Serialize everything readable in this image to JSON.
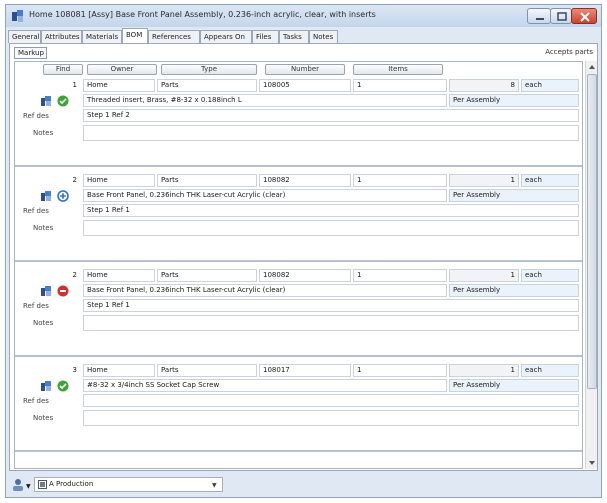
{
  "window": {
    "title": "Home 108081 [Assy] Base Front Panel Assembly, 0.236-inch acrylic, clear, with inserts"
  },
  "tabs": [
    {
      "label": "General"
    },
    {
      "label": "Attributes"
    },
    {
      "label": "Materials"
    },
    {
      "label": "BOM",
      "active": true
    },
    {
      "label": "References"
    },
    {
      "label": "Appears On"
    },
    {
      "label": "Files"
    },
    {
      "label": "Tasks"
    },
    {
      "label": "Notes"
    }
  ],
  "subtab": {
    "label": "Markup"
  },
  "accepts_parts": "Accepts parts",
  "columns": {
    "find": "Find",
    "owner": "Owner",
    "type": "Type",
    "number": "Number",
    "items": "Items"
  },
  "row_labels": {
    "ref_des": "Ref des",
    "notes": "Notes"
  },
  "bom_items": [
    {
      "find": "1",
      "owner": "Home",
      "type": "Parts",
      "number": "108005",
      "rev": "1",
      "qty": "8",
      "unit": "each",
      "description": "Threaded insert, Brass, #8-32 x 0.188inch L",
      "per": "Per Assembly",
      "ref_des": "Step 1 Ref 2",
      "notes": "",
      "status": "check"
    },
    {
      "find": "2",
      "owner": "Home",
      "type": "Parts",
      "number": "108082",
      "rev": "1",
      "qty": "1",
      "unit": "each",
      "description": "Base Front Panel, 0.236inch THK Laser-cut Acrylic (clear)",
      "per": "Per Assembly",
      "ref_des": "Step 1 Ref 1",
      "notes": "",
      "status": "add"
    },
    {
      "find": "2",
      "owner": "Home",
      "type": "Parts",
      "number": "108082",
      "rev": "1",
      "qty": "1",
      "unit": "each",
      "description": "Base Front Panel, 0.236inch THK Laser-cut Acrylic (clear)",
      "per": "Per Assembly",
      "ref_des": "Step 1 Ref 1",
      "notes": "",
      "status": "remove"
    },
    {
      "find": "3",
      "owner": "Home",
      "type": "Parts",
      "number": "108017",
      "rev": "1",
      "qty": "1",
      "unit": "each",
      "description": "#8-32 x 3/4inch SS Socket Cap Screw",
      "per": "Per Assembly",
      "ref_des": "",
      "notes": "",
      "status": "check"
    }
  ],
  "statusbar": {
    "lifecycle": "A Production"
  },
  "colors": {
    "check": "#3aa635",
    "add": "#2f6fd1",
    "remove": "#d22f2f",
    "window_bg": "#dfe8f3"
  }
}
